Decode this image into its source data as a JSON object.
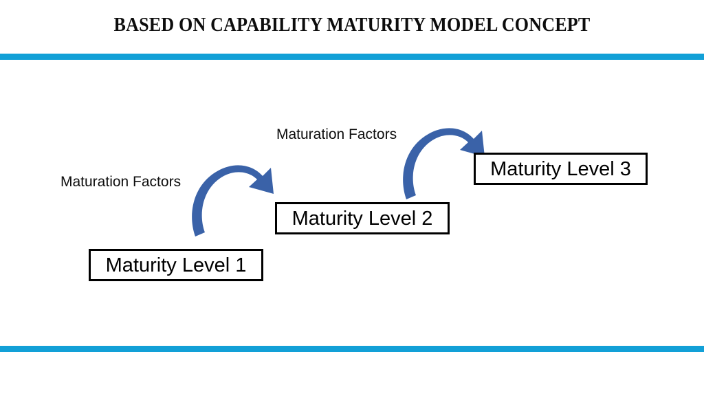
{
  "slide": {
    "title": "BASED ON CAPABILITY MATURITY MODEL CONCEPT",
    "background_color": "#FFFFFF"
  },
  "dividers": {
    "color": "#12A0D7",
    "top_label": "top-divider-bar",
    "bottom_label": "bottom-divider-bar"
  },
  "diagram": {
    "type": "staircase-progression",
    "box_border_color": "#000000",
    "arrow_color": "#3A62A8",
    "boxes": [
      {
        "label": "Maturity Level 1"
      },
      {
        "label": "Maturity Level 2"
      },
      {
        "label": "Maturity Level 3"
      }
    ],
    "captions": [
      {
        "label": "Maturation Factors"
      },
      {
        "label": "Maturation Factors"
      }
    ],
    "arrows": [
      {
        "name": "arrow-level1-to-level2",
        "direction": "up-right"
      },
      {
        "name": "arrow-level2-to-level3",
        "direction": "up-right"
      }
    ]
  }
}
